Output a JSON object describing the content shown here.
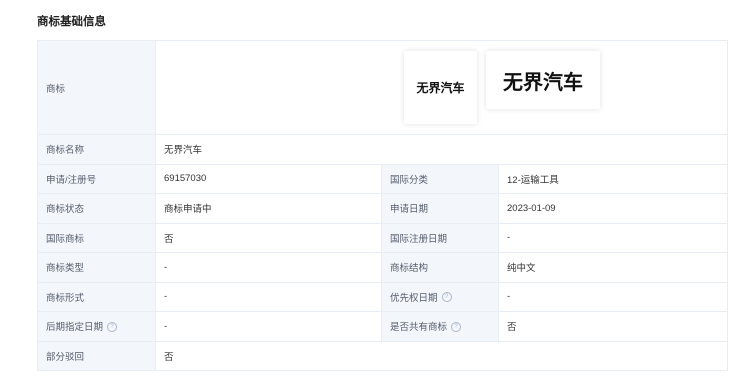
{
  "section": {
    "title": "商标基础信息"
  },
  "trademark": {
    "label": "商标",
    "logo_small_text": "无界汽车",
    "logo_large_text": "无界汽车"
  },
  "rows": {
    "name": {
      "label": "商标名称",
      "value": "无界汽车"
    },
    "reg_no": {
      "label": "申请/注册号",
      "value": "69157030"
    },
    "intl_class": {
      "label": "国际分类",
      "value": "12-运输工具"
    },
    "status": {
      "label": "商标状态",
      "value": "商标申请中"
    },
    "apply_date": {
      "label": "申请日期",
      "value": "2023-01-09"
    },
    "intl_mark": {
      "label": "国际商标",
      "value": "否"
    },
    "intl_reg_date": {
      "label": "国际注册日期",
      "value": "-"
    },
    "type": {
      "label": "商标类型",
      "value": "-"
    },
    "structure": {
      "label": "商标结构",
      "value": "纯中文"
    },
    "form": {
      "label": "商标形式",
      "value": "-"
    },
    "priority_date": {
      "label": "优先权日期",
      "value": "-"
    },
    "later_designation_date": {
      "label": "后期指定日期",
      "value": "-"
    },
    "shared": {
      "label": "是否共有商标",
      "value": "否"
    },
    "partial_reject": {
      "label": "部分驳回",
      "value": "否"
    }
  },
  "icons": {
    "help": "question-circle-icon"
  },
  "colors": {
    "label_bg": "#f3f6fb",
    "border": "#e8ecf3",
    "help_icon": "#a9b7cf"
  }
}
